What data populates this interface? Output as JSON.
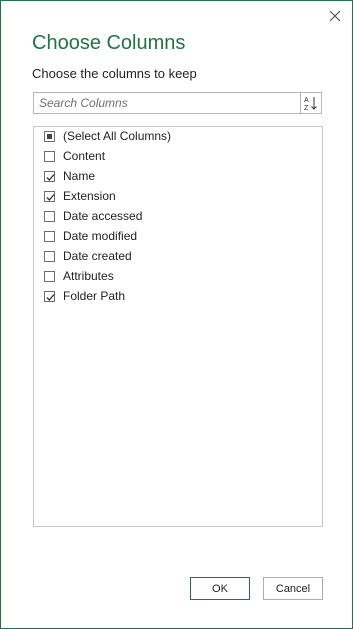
{
  "dialog": {
    "title": "Choose Columns",
    "subtitle": "Choose the columns to keep",
    "search": {
      "placeholder": "Search Columns",
      "value": ""
    },
    "sort_icon": "sort-az-icon",
    "close_icon": "close-icon",
    "columns": [
      {
        "label": "(Select All Columns)",
        "state": "partial"
      },
      {
        "label": "Content",
        "state": "unchecked"
      },
      {
        "label": "Name",
        "state": "checked"
      },
      {
        "label": "Extension",
        "state": "checked"
      },
      {
        "label": "Date accessed",
        "state": "unchecked"
      },
      {
        "label": "Date modified",
        "state": "unchecked"
      },
      {
        "label": "Date created",
        "state": "unchecked"
      },
      {
        "label": "Attributes",
        "state": "unchecked"
      },
      {
        "label": "Folder Path",
        "state": "checked"
      }
    ],
    "ok_label": "OK",
    "cancel_label": "Cancel"
  },
  "colors": {
    "accent": "#217346"
  }
}
